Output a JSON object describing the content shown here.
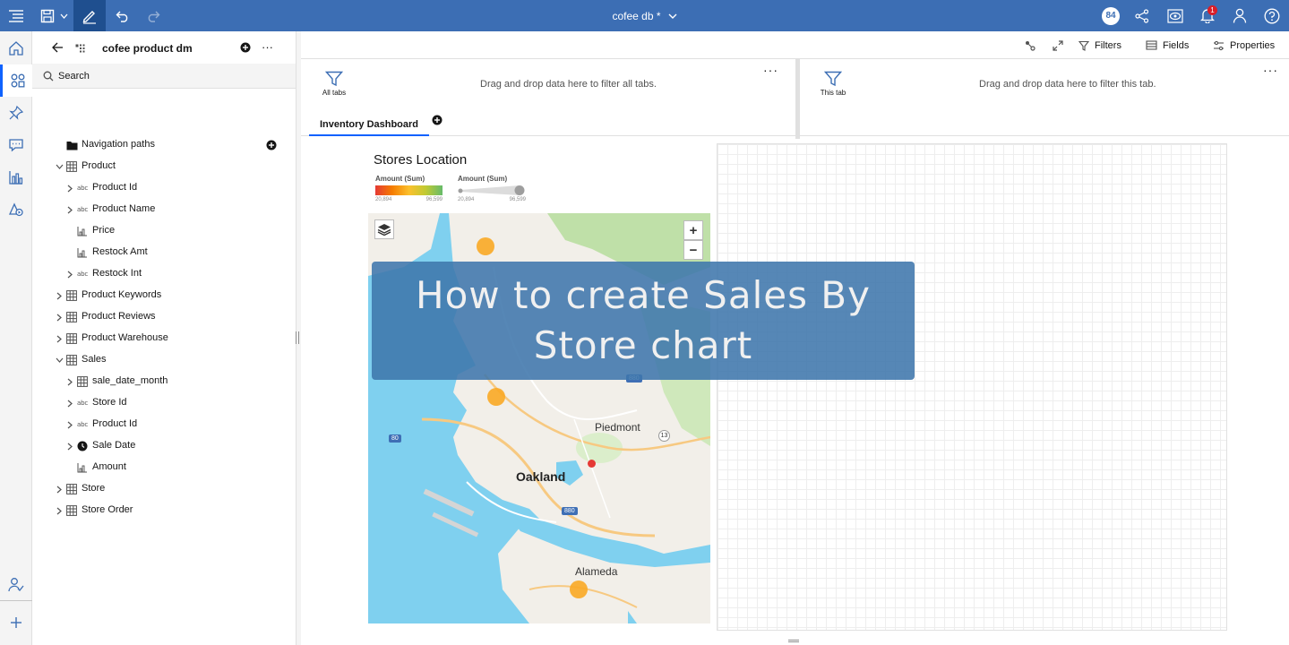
{
  "app": {
    "title": "cofee db *",
    "notification_badge": "84",
    "alert_count": "1"
  },
  "data_panel": {
    "title": "cofee product dm",
    "more": "···",
    "search_placeholder": "Search",
    "tree": [
      {
        "label": "Navigation paths",
        "icon": "folder-icon"
      },
      {
        "label": "Product",
        "icon": "table-icon"
      },
      {
        "label": "Product Id",
        "icon": "abc-icon"
      },
      {
        "label": "Product Name",
        "icon": "abc-icon"
      },
      {
        "label": "Price",
        "icon": "measure-icon"
      },
      {
        "label": "Restock Amt",
        "icon": "measure-icon"
      },
      {
        "label": "Restock Int",
        "icon": "abc-icon"
      },
      {
        "label": "Product Keywords",
        "icon": "table-icon"
      },
      {
        "label": "Product Reviews",
        "icon": "table-icon"
      },
      {
        "label": "Product Warehouse",
        "icon": "table-icon"
      },
      {
        "label": "Sales",
        "icon": "table-icon"
      },
      {
        "label": "sale_date_month",
        "icon": "table-icon"
      },
      {
        "label": "Store Id",
        "icon": "abc-icon"
      },
      {
        "label": "Product Id",
        "icon": "abc-icon"
      },
      {
        "label": "Sale Date",
        "icon": "clock-icon"
      },
      {
        "label": "Amount",
        "icon": "measure-icon"
      },
      {
        "label": "Store",
        "icon": "table-icon"
      },
      {
        "label": "Store Order",
        "icon": "table-icon"
      }
    ]
  },
  "toolbar": {
    "filters": "Filters",
    "fields": "Fields",
    "properties": "Properties"
  },
  "filters": {
    "all_tabs_label": "All tabs",
    "all_tabs_hint": "Drag and drop data here to filter all tabs.",
    "this_tab_label": "This tab",
    "this_tab_hint": "Drag and drop data here to filter this tab.",
    "more": "···"
  },
  "tabs": [
    {
      "label": "Inventory Dashboard"
    }
  ],
  "widget": {
    "title": "Stores Location",
    "legend_color": {
      "label": "Amount (Sum)",
      "min": "20,894",
      "max": "96,599"
    },
    "legend_size": {
      "label": "Amount (Sum)",
      "min": "20,894",
      "max": "96,599"
    },
    "map_labels": {
      "piedmont": "Piedmont",
      "oakland": "Oakland",
      "alameda": "Alameda",
      "shield_80": "80",
      "shield_13": "13",
      "shield_880a": "880",
      "shield_880b": "880"
    },
    "zoom_in": "+",
    "zoom_out": "−"
  },
  "overlay": {
    "text": "How to create Sales By Store chart"
  },
  "colors": {
    "topbar": "#3c6eb4",
    "accent": "#0f62fe",
    "marker_orange": "#f9a825",
    "marker_red": "#e53935"
  }
}
